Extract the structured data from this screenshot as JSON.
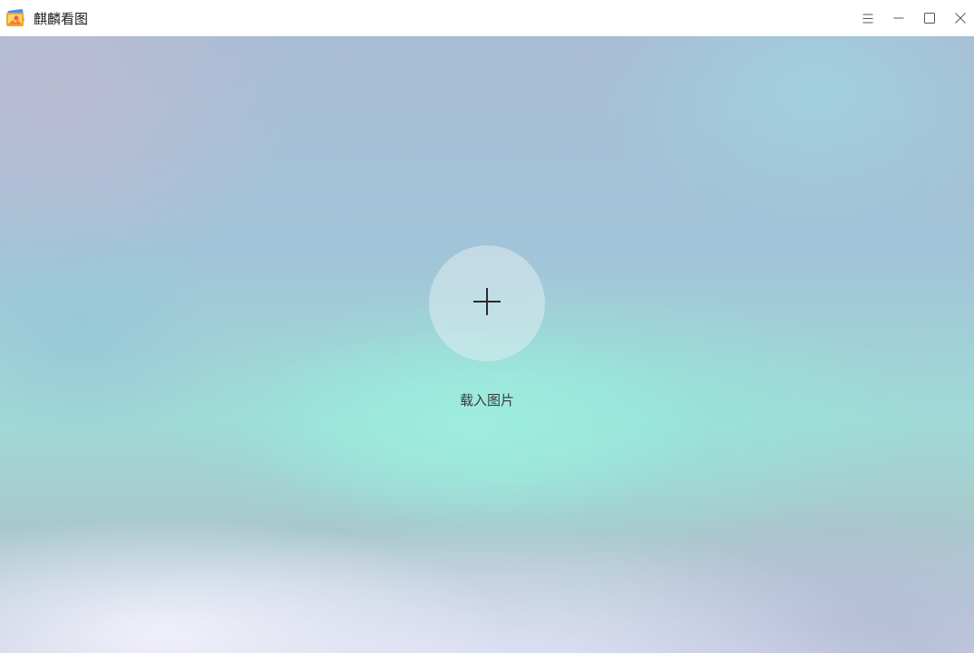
{
  "window": {
    "title": "麒麟看图",
    "icons": {
      "app": "image-viewer-app-icon",
      "menu": "hamburger-menu-icon",
      "minimize": "minimize-icon",
      "maximize": "maximize-icon",
      "close": "close-icon"
    }
  },
  "main": {
    "load_button_icon": "plus-icon",
    "load_label": "载入图片"
  },
  "colors": {
    "titlebar_bg": "#ffffff",
    "title_text": "#1a1a1a",
    "label_text": "#3a3a3a",
    "accent_teal": "#9feede"
  }
}
